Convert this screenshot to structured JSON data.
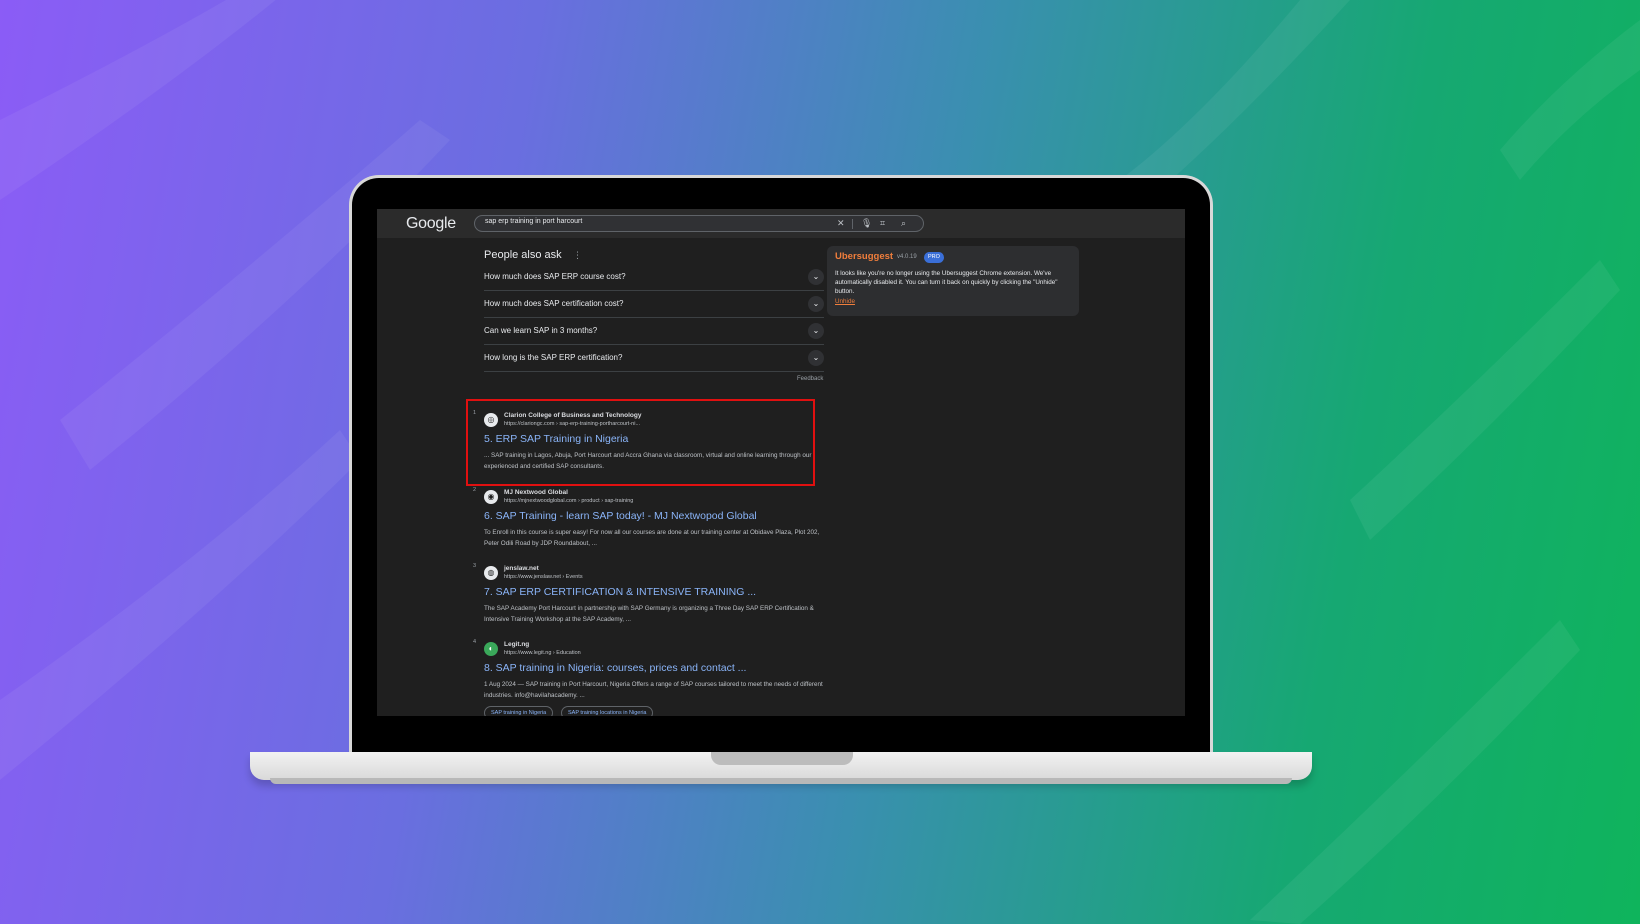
{
  "google": {
    "logo": "Google",
    "query": "sap erp training in port harcourt"
  },
  "paa": {
    "title": "People also ask",
    "questions": [
      "How much does SAP ERP course cost?",
      "How much does SAP certification cost?",
      "Can we learn SAP in 3 months?",
      "How long is the SAP ERP certification?"
    ],
    "feedback": "Feedback"
  },
  "results": [
    {
      "num": "1",
      "site": "Clarion College of Business and Technology",
      "url": "https://clariongc.com › sap-erp-training-portharcourt-ni...",
      "title": "5. ERP SAP Training in Nigeria",
      "snippet": "... SAP training in Lagos, Abuja, Port Harcourt and Accra Ghana via classroom, virtual and online learning through our experienced and certified SAP consultants."
    },
    {
      "num": "2",
      "site": "MJ Nextwood Global",
      "url": "https://mjnextwoodglobal.com › product › sap-training",
      "title": "6. SAP Training - learn SAP today! - MJ Nextwopod Global",
      "snippet": "To Enroll in this course is super easy! For now all our courses are done at our training center at Obidave Plaza, Plot 202, Peter Odili Road by JDP Roundabout, ..."
    },
    {
      "num": "3",
      "site": "jenslaw.net",
      "url": "https://www.jenslaw.net › Events",
      "title": "7. SAP ERP CERTIFICATION & INTENSIVE TRAINING ...",
      "snippet": "The SAP Academy Port Harcourt in partnership with SAP Germany is organizing a Three Day SAP ERP Certification & Intensive Training Workshop at the SAP Academy, ..."
    },
    {
      "num": "4",
      "site": "Legit.ng",
      "url": "https://www.legit.ng › Education",
      "title": "8. SAP training in Nigeria: courses, prices and contact ...",
      "snippet": "1 Aug 2024 — SAP training in Port Harcourt, Nigeria Offers a range of SAP courses tailored to meet the needs of different industries. info@havilahacademy. ..."
    }
  ],
  "chips": [
    "SAP training in Nigeria",
    "SAP training locations in Nigeria"
  ],
  "ubersuggest": {
    "name": "Ubersuggest",
    "version": "v4.0.19",
    "badge": "PRO",
    "message": "It looks like you're no longer using the Ubersuggest Chrome extension. We've automatically disabled it. You can turn it back on quickly by clicking the \"Unhide\" button.",
    "unhide": "Unhide"
  },
  "colors": {
    "highlight": "#e01010",
    "link": "#8ab4f8",
    "brand_orange": "#f07e3c"
  }
}
